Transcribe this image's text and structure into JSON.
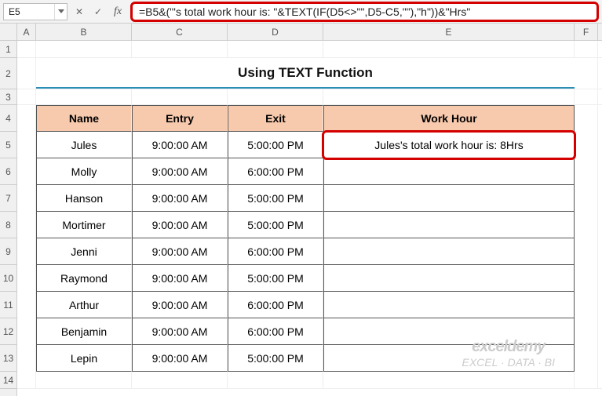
{
  "namebox": {
    "value": "E5"
  },
  "formula": "=B5&(\"'s total work hour is: \"&TEXT(IF(D5<>\"\",D5-C5,\"\"),\"h\"))&\"Hrs\"",
  "columns": [
    "A",
    "B",
    "C",
    "D",
    "E",
    "F"
  ],
  "rows": [
    "1",
    "2",
    "3",
    "4",
    "5",
    "6",
    "7",
    "8",
    "9",
    "10",
    "11",
    "12",
    "13",
    "14"
  ],
  "title": "Using TEXT Function",
  "headers": {
    "B": "Name",
    "C": "Entry",
    "D": "Exit",
    "E": "Work Hour"
  },
  "data": [
    {
      "name": "Jules",
      "entry": "9:00:00 AM",
      "exit": "5:00:00 PM",
      "work": "Jules's total work hour is: 8Hrs"
    },
    {
      "name": "Molly",
      "entry": "9:00:00 AM",
      "exit": "6:00:00 PM",
      "work": ""
    },
    {
      "name": "Hanson",
      "entry": "9:00:00 AM",
      "exit": "5:00:00 PM",
      "work": ""
    },
    {
      "name": "Mortimer",
      "entry": "9:00:00 AM",
      "exit": "5:00:00 PM",
      "work": ""
    },
    {
      "name": "Jenni",
      "entry": "9:00:00 AM",
      "exit": "6:00:00 PM",
      "work": ""
    },
    {
      "name": "Raymond",
      "entry": "9:00:00 AM",
      "exit": "5:00:00 PM",
      "work": ""
    },
    {
      "name": "Arthur",
      "entry": "9:00:00 AM",
      "exit": "6:00:00 PM",
      "work": ""
    },
    {
      "name": "Benjamin",
      "entry": "9:00:00 AM",
      "exit": "6:00:00 PM",
      "work": ""
    },
    {
      "name": "Lepin",
      "entry": "9:00:00 AM",
      "exit": "5:00:00 PM",
      "work": ""
    }
  ],
  "watermark": {
    "main": "exceldemy",
    "sub": "EXCEL · DATA · BI"
  }
}
